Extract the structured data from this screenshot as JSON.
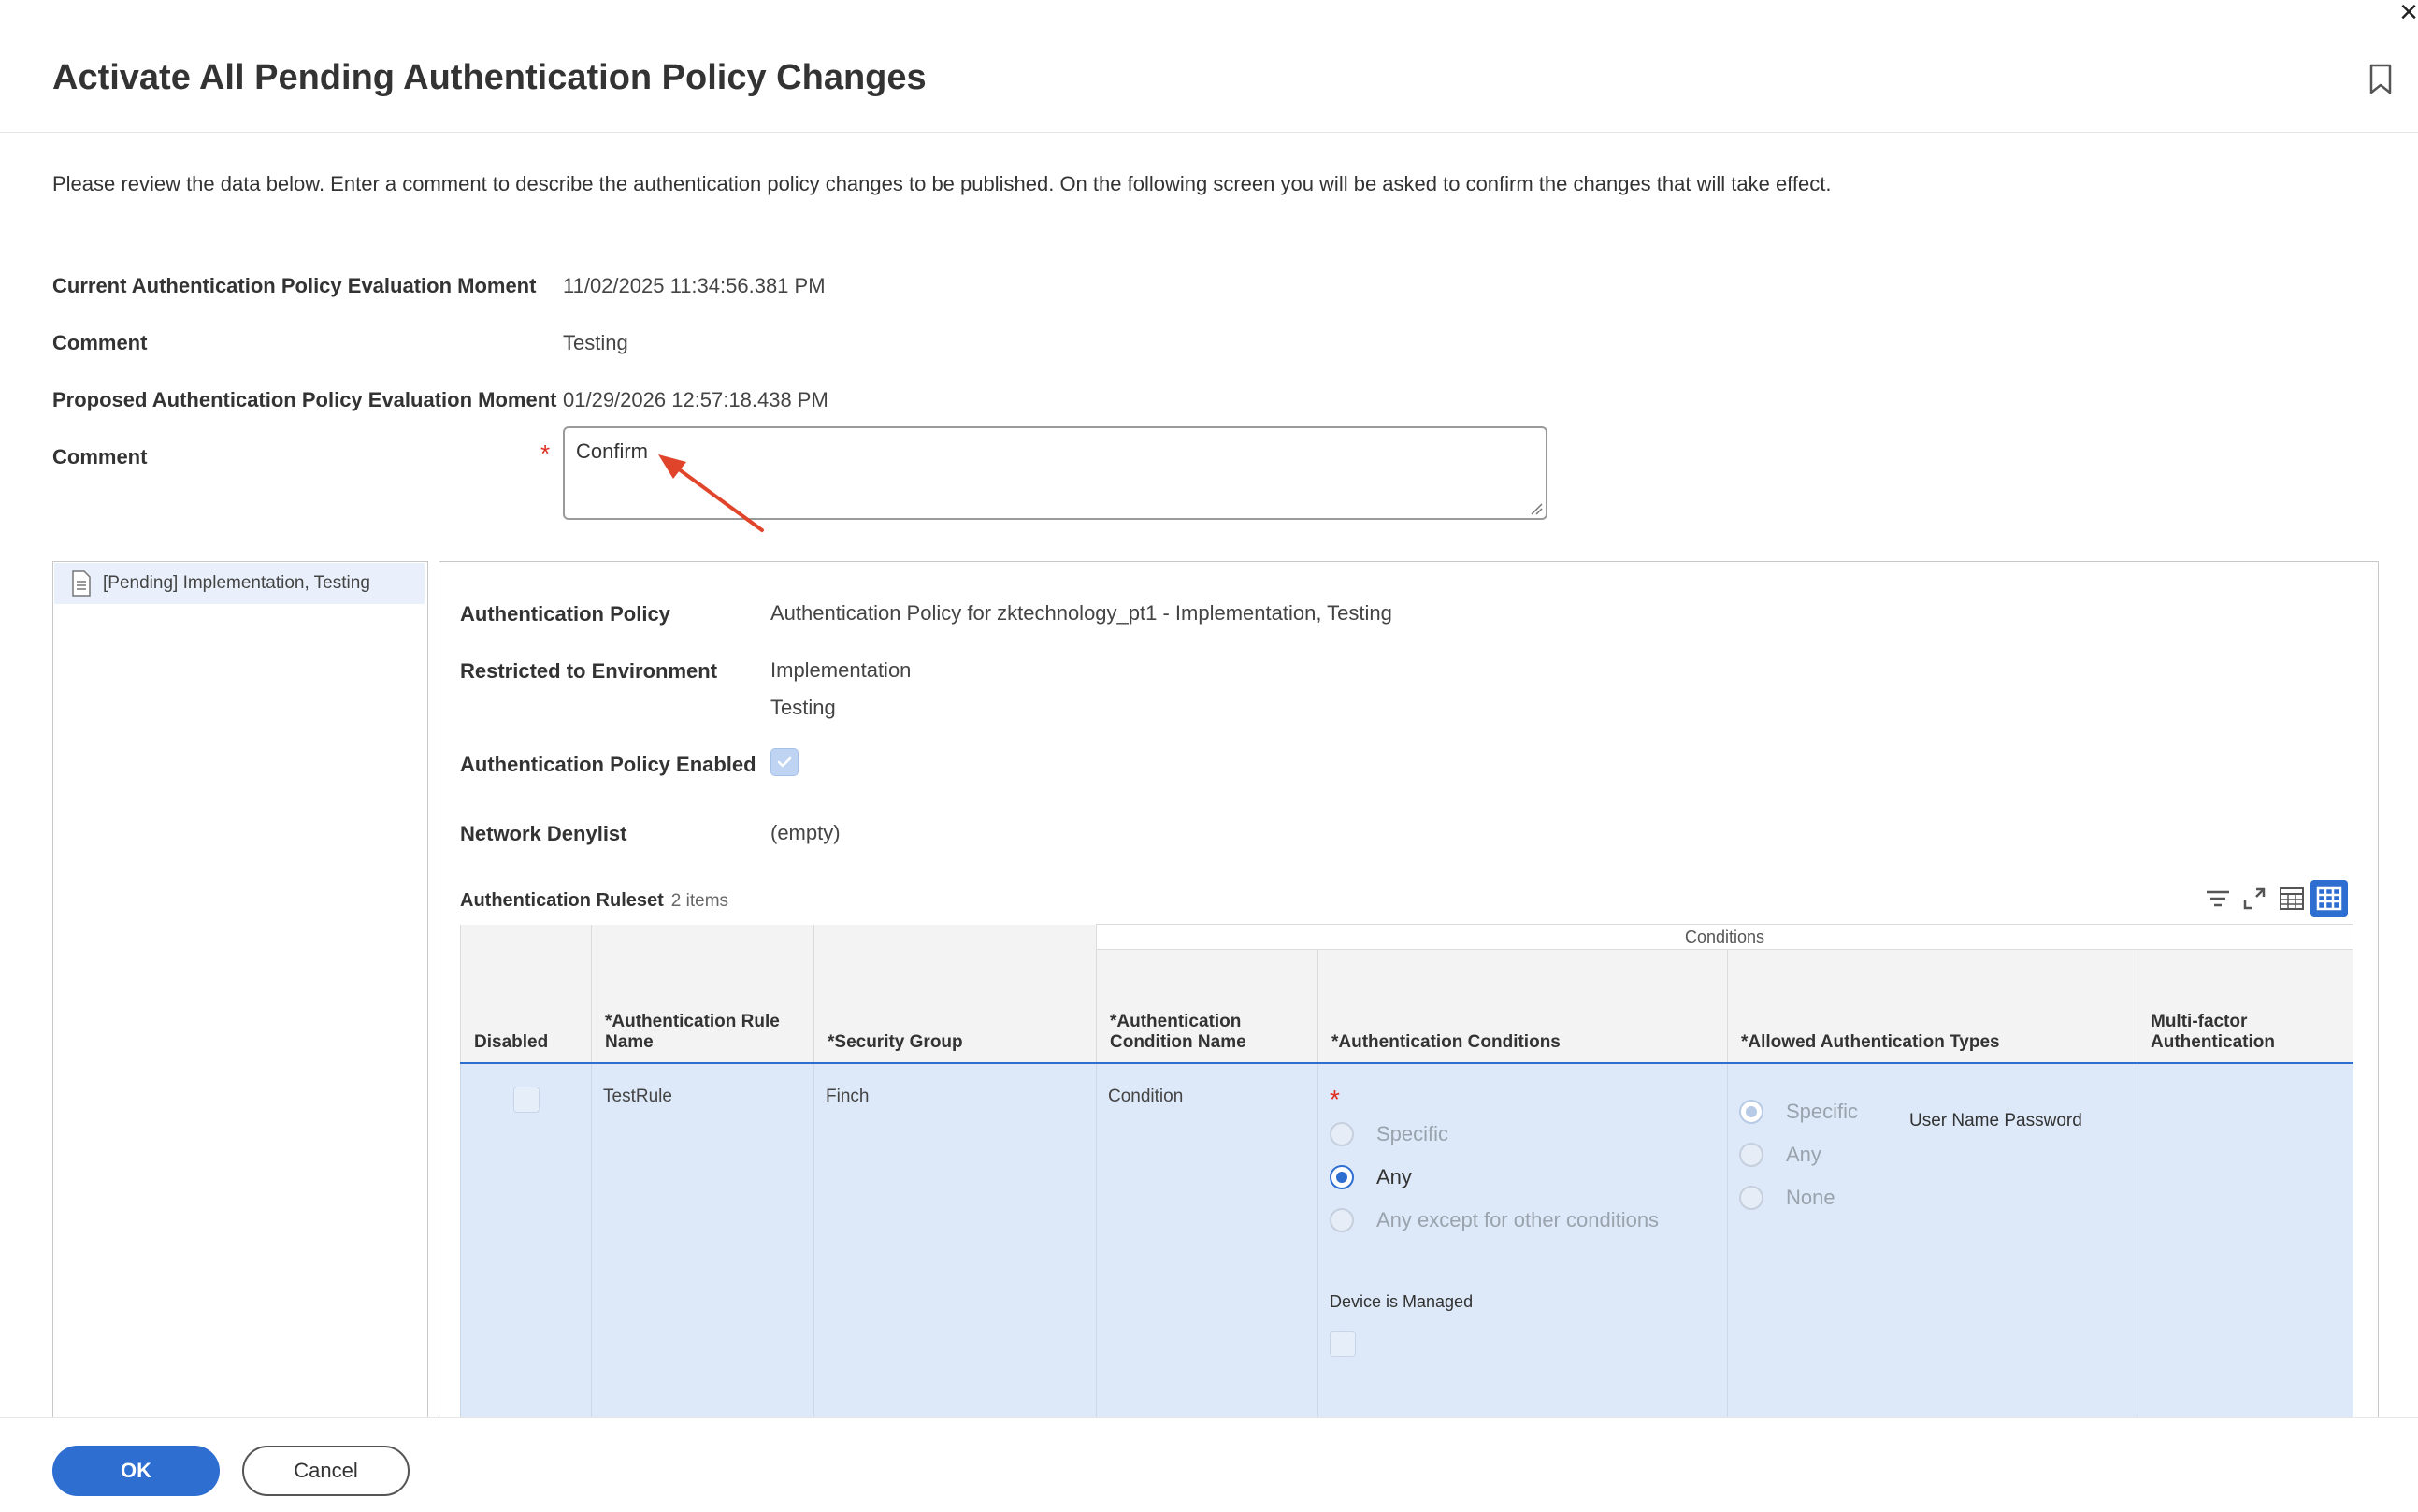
{
  "window": {
    "close_icon": "close-icon"
  },
  "header": {
    "title": "Activate All Pending Authentication Policy Changes",
    "bookmark_icon": "bookmark-icon"
  },
  "intro": "Please review the data below. Enter a comment to describe the authentication policy changes to be published. On the following screen you will be asked to confirm the changes that will take effect.",
  "fields": {
    "current_label": "Current Authentication Policy Evaluation Moment",
    "current_value": "11/02/2025 11:34:56.381 PM",
    "comment1_label": "Comment",
    "comment1_value": "Testing",
    "proposed_label": "Proposed Authentication Policy Evaluation Moment",
    "proposed_value": "01/29/2026 12:57:18.438 PM",
    "comment2_label": "Comment",
    "comment2_required": "*",
    "comment2_value": "Confirm"
  },
  "left_pane": {
    "items": [
      {
        "label": "[Pending] Implementation, Testing",
        "icon": "document-icon"
      }
    ]
  },
  "details": {
    "policy_label": "Authentication Policy",
    "policy_value": "Authentication Policy for zktechnology_pt1 - Implementation, Testing",
    "restricted_label": "Restricted to Environment",
    "restricted_values": [
      "Implementation",
      "Testing"
    ],
    "enabled_label": "Authentication Policy Enabled",
    "enabled_value": true,
    "denylist_label": "Network Denylist",
    "denylist_value": "(empty)"
  },
  "ruleset": {
    "title": "Authentication Ruleset",
    "count": "2 items",
    "toolbar_icons": [
      "filter-icon",
      "expand-icon",
      "table-view-icon",
      "grid-view-icon"
    ],
    "group_header": "Conditions",
    "columns": [
      "Disabled",
      "*Authentication Rule Name",
      "*Security Group",
      "*Authentication Condition Name",
      "*Authentication Conditions",
      "*Allowed Authentication Types",
      "Multi-factor Authentication"
    ],
    "row": {
      "disabled": false,
      "rule_name": "TestRule",
      "security_group": "Finch",
      "condition_name": "Condition",
      "conditions_required": "*",
      "condition_options": [
        "Specific",
        "Any",
        "Any except for other conditions"
      ],
      "condition_selected": "Any",
      "device_managed_label": "Device is Managed",
      "device_managed": false,
      "auth_type_options": [
        "Specific",
        "Any",
        "None"
      ],
      "auth_type_selected": "Specific",
      "auth_type_value": "User Name Password",
      "mfa": ""
    }
  },
  "footer": {
    "ok_label": "OK",
    "cancel_label": "Cancel"
  },
  "colors": {
    "accent": "#2e6ed1",
    "required": "#de2e21",
    "row_selected": "#dde9f8",
    "annotation_arrow": "#e0452b"
  }
}
